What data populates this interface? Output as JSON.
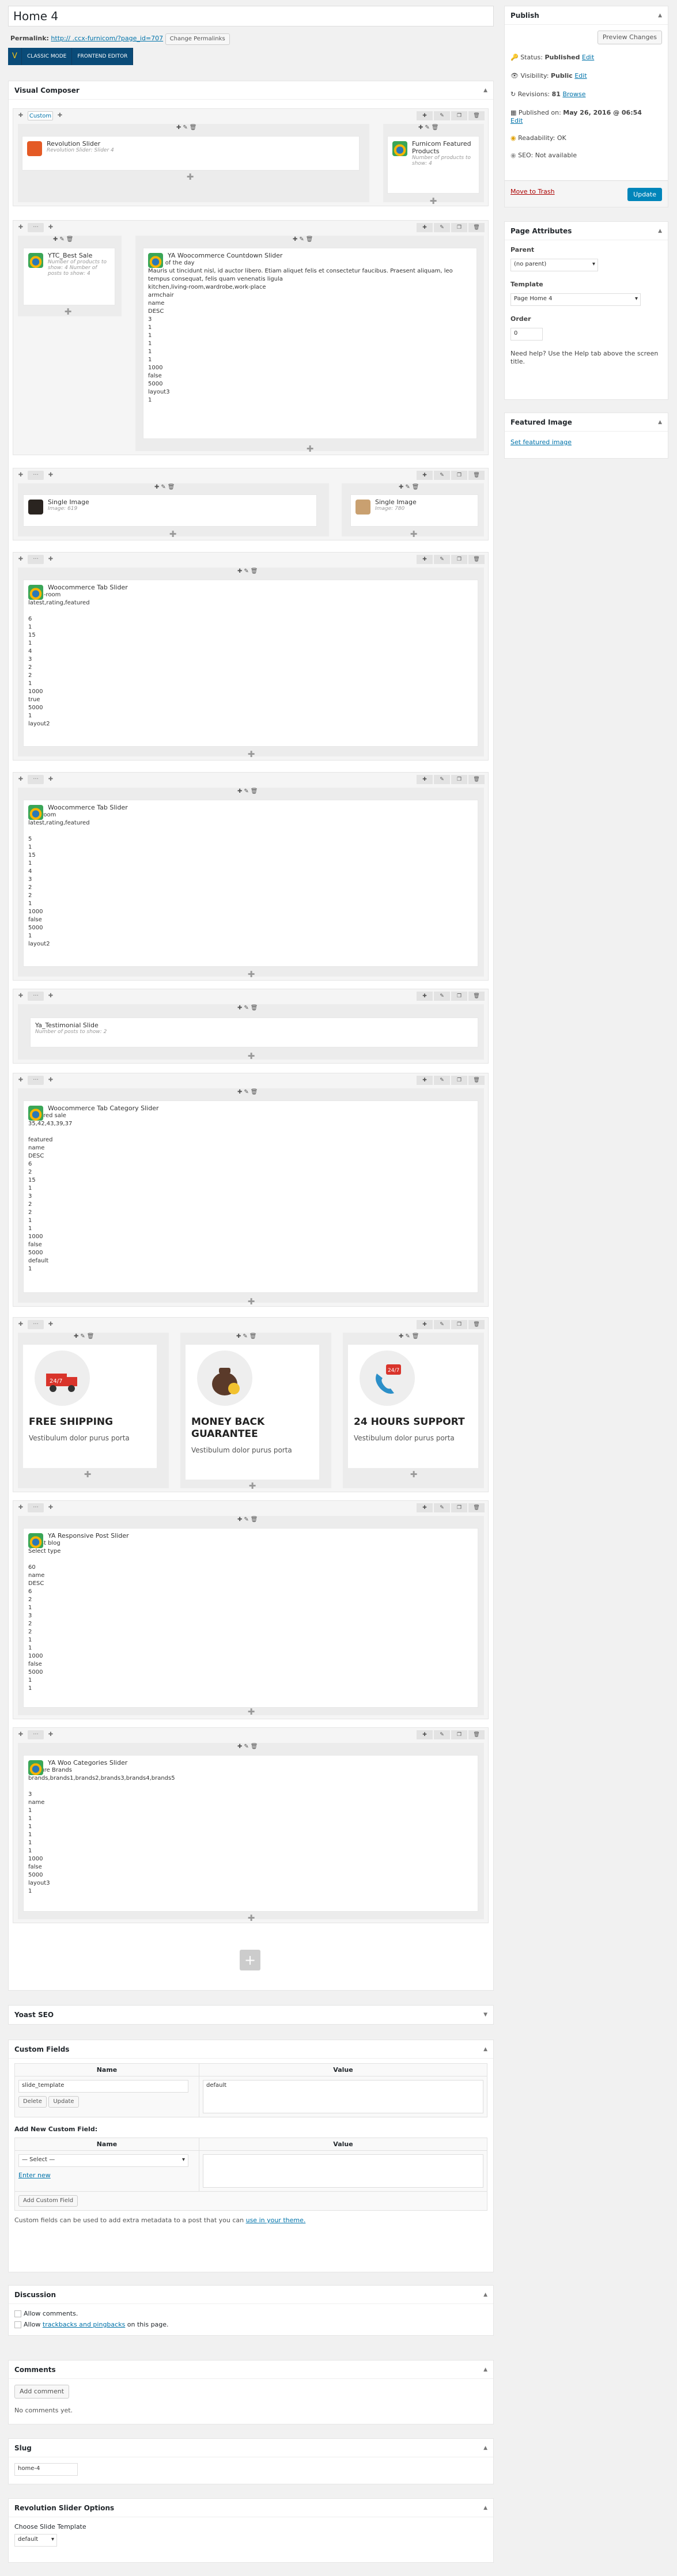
{
  "title": "Home 4",
  "permalink": {
    "label": "Permalink:",
    "url": "http://                                         .ccx-furnicom/?page_id=707",
    "button": "Change Permalinks"
  },
  "vc": {
    "classic": "CLASSIC MODE",
    "frontend": "FRONTEND EDITOR",
    "panel_title": "Visual Composer",
    "logo": "V"
  },
  "rows": [
    {
      "tab": "Custom"
    },
    {},
    {},
    {},
    {},
    {},
    {},
    {},
    {},
    {},
    {}
  ],
  "elements": {
    "revslider": {
      "name": "Revolution Slider",
      "sub": "Revolution Slider: Slider 4"
    },
    "furnicom": {
      "name": "Furnicom Featured Products",
      "sub": "Number of products to show: 4"
    },
    "bestsale": {
      "name": "YTC_Best Sale",
      "sub": "Number of products to show: 4 Number of posts to show: 4"
    },
    "countdown": {
      "name": "YA Woocommerce Countdown Slider",
      "text": "deals of the day\nMauris ut tincidunt nisl, id auctor libero. Etiam aliquet felis et consectetur faucibus. Praesent aliquam, leo tempus consequat, felis quam venenatis ligula\nkitchen,living-room,wardrobe,work-place\narmchair\nname\nDESC\n3\n1\n1\n1\n1\n1\n1000\nfalse\n5000\nlayout3\n1"
    },
    "img1": {
      "name": "Single Image",
      "sub": "Image: 619"
    },
    "img2": {
      "name": "Single Image",
      "sub": "Image: 780"
    },
    "tab1": {
      "name": "Woocommerce Tab Slider",
      "text": "living-room\nlatest,rating,featured\n\n6\n1\n15\n1\n4\n3\n2\n2\n1\n1000\ntrue\n5000\n1\nlayout2"
    },
    "tab2": {
      "name": "Woocommerce Tab Slider",
      "text": "bed-room\nlatest,rating,featured\n\n5\n1\n15\n1\n4\n3\n2\n2\n1\n1000\nfalse\n5000\n1\nlayout2"
    },
    "testimonial": {
      "name": "Ya_Testimonial Slide",
      "sub": "Number of posts to show: 2"
    },
    "category": {
      "name": "Woocommerce Tab Category Slider",
      "text": "featured sale\n35,42,43,39,37\n\nfeatured\nname\nDESC\n6\n2\n15\n1\n3\n2\n2\n1\n1\n1000\nfalse\n5000\ndefault\n1"
    },
    "post": {
      "name": "YA Responsive Post Slider",
      "text": "Latest blog\nSelect type\n\n60\nname\nDESC\n6\n2\n1\n3\n2\n2\n1\n1\n1000\nfalse\n5000\n1\n1"
    },
    "cats": {
      "name": "YA Woo Categories Slider",
      "text": "Feature Brands\nbrands,brands1,brands2,brands3,brands4,brands5\n\n3\nname\n1\n1\n1\n1\n1\n1\n1000\nfalse\n5000\nlayout3\n1"
    }
  },
  "features": [
    {
      "title": "FREE SHIPPING",
      "text": "Vestibulum dolor purus porta",
      "icon": "truck-icon",
      "badge": "24/7"
    },
    {
      "title": "MONEY BACK GUARANTEE",
      "text": "Vestibulum dolor purus porta",
      "icon": "money-bag-icon"
    },
    {
      "title": "24 HOURS SUPPORT",
      "text": "Vestibulum dolor purus porta",
      "icon": "phone-support-icon",
      "badge": "24/7"
    }
  ],
  "publish": {
    "title": "Publish",
    "preview": "Preview Changes",
    "status_label": "Status:",
    "status": "Published",
    "visibility_label": "Visibility:",
    "visibility": "Public",
    "revisions_label": "Revisions:",
    "revisions": "81",
    "browse": "Browse",
    "published_label": "Published on:",
    "published": "May 26, 2016 @ 06:54",
    "readability": "Readability: OK",
    "seo": "SEO: Not available",
    "trash": "Move to Trash",
    "update": "Update",
    "edit": "Edit"
  },
  "attributes": {
    "title": "Page Attributes",
    "parent_label": "Parent",
    "parent": "(no parent)",
    "template_label": "Template",
    "template": "Page Home 4",
    "order_label": "Order",
    "order": "0",
    "help": "Need help? Use the Help tab above the screen title."
  },
  "featured": {
    "title": "Featured Image",
    "link": "Set featured image"
  },
  "yoast": {
    "title": "Yoast SEO"
  },
  "custom_fields": {
    "title": "Custom Fields",
    "name_col": "Name",
    "value_col": "Value",
    "key": "slide_template",
    "value": "default",
    "delete": "Delete",
    "update": "Update",
    "add_title": "Add New Custom Field:",
    "select": "— Select —",
    "enter_new": "Enter new",
    "add_btn": "Add Custom Field",
    "note": "Custom fields can be used to add extra metadata to a post that you can",
    "note_link": "use in your theme."
  },
  "discussion": {
    "title": "Discussion",
    "allow_comments": "Allow comments.",
    "allow_prefix": "Allow",
    "allow_link": "trackbacks and pingbacks",
    "allow_suffix": "on this page."
  },
  "comments": {
    "title": "Comments",
    "add": "Add comment",
    "none": "No comments yet."
  },
  "slug": {
    "title": "Slug",
    "value": "home-4"
  },
  "revslider_opts": {
    "title": "Revolution Slider Options",
    "label": "Choose Slide Template",
    "value": "default"
  },
  "colors": {
    "accent": "#0073aa",
    "vc": "#0a4b78",
    "update": "#0085ba"
  }
}
